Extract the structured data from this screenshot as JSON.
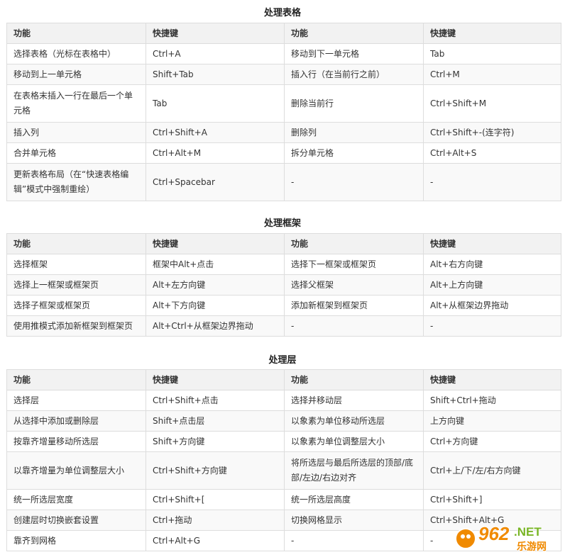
{
  "header": {
    "func": "功能",
    "key": "快捷键"
  },
  "sections": [
    {
      "title": "处理表格",
      "rows": [
        [
          "选择表格（光标在表格中）",
          "Ctrl+A",
          "移动到下一单元格",
          "Tab"
        ],
        [
          "移动到上一单元格",
          "Shift+Tab",
          "插入行（在当前行之前）",
          "Ctrl+M"
        ],
        [
          "在表格末插入一行在最后一个单元格",
          "Tab",
          "删除当前行",
          "Ctrl+Shift+M"
        ],
        [
          "插入列",
          "Ctrl+Shift+A",
          "删除列",
          "Ctrl+Shift+-(连字符)"
        ],
        [
          "合并单元格",
          "Ctrl+Alt+M",
          "拆分单元格",
          "Ctrl+Alt+S"
        ],
        [
          "更新表格布局（在“快速表格编辑”模式中强制重绘）",
          "Ctrl+Spacebar",
          "-",
          "-"
        ]
      ]
    },
    {
      "title": "处理框架",
      "rows": [
        [
          "选择框架",
          "框架中Alt+点击",
          "选择下一框架或框架页",
          "Alt+右方向键"
        ],
        [
          "选择上一框架或框架页",
          "Alt+左方向键",
          "选择父框架",
          "Alt+上方向键"
        ],
        [
          "选择子框架或框架页",
          "Alt+下方向键",
          "添加新框架到框架页",
          "Alt+从框架边界拖动"
        ],
        [
          "使用推模式添加新框架到框架页",
          "Alt+Ctrl+从框架边界拖动",
          "-",
          "-"
        ]
      ]
    },
    {
      "title": "处理层",
      "rows": [
        [
          "选择层",
          "Ctrl+Shift+点击",
          "选择并移动层",
          "Shift+Ctrl+拖动"
        ],
        [
          "从选择中添加或删除层",
          "Shift+点击层",
          "以象素为单位移动所选层",
          "上方向键"
        ],
        [
          "按靠齐增量移动所选层",
          "Shift+方向键",
          "以象素为单位调整层大小",
          "Ctrl+方向键"
        ],
        [
          "以靠齐增量为单位调整层大小",
          "Ctrl+Shift+方向键",
          "将所选层与最后所选层的顶部/底部/左边/右边对齐",
          "Ctrl+上/下/左/右方向键"
        ],
        [
          "统一所选层宽度",
          "Ctrl+Shift+[",
          "统一所选层高度",
          "Ctrl+Shift+]"
        ],
        [
          "创建层时切换嵌套设置",
          "Ctrl+拖动",
          "切换网格显示",
          "Ctrl+Shift+Alt+G"
        ],
        [
          "靠齐到网格",
          "Ctrl+Alt+G",
          "-",
          "-"
        ]
      ]
    }
  ],
  "watermark": {
    "number": "962",
    "domain": ".NET",
    "subtitle": "乐游网"
  },
  "colors": {
    "border": "#dddddd",
    "header_bg": "#f2f2f2",
    "alt_row_bg": "#f9f9f9",
    "watermark_orange": "#f08a00",
    "watermark_green": "#79b526"
  }
}
